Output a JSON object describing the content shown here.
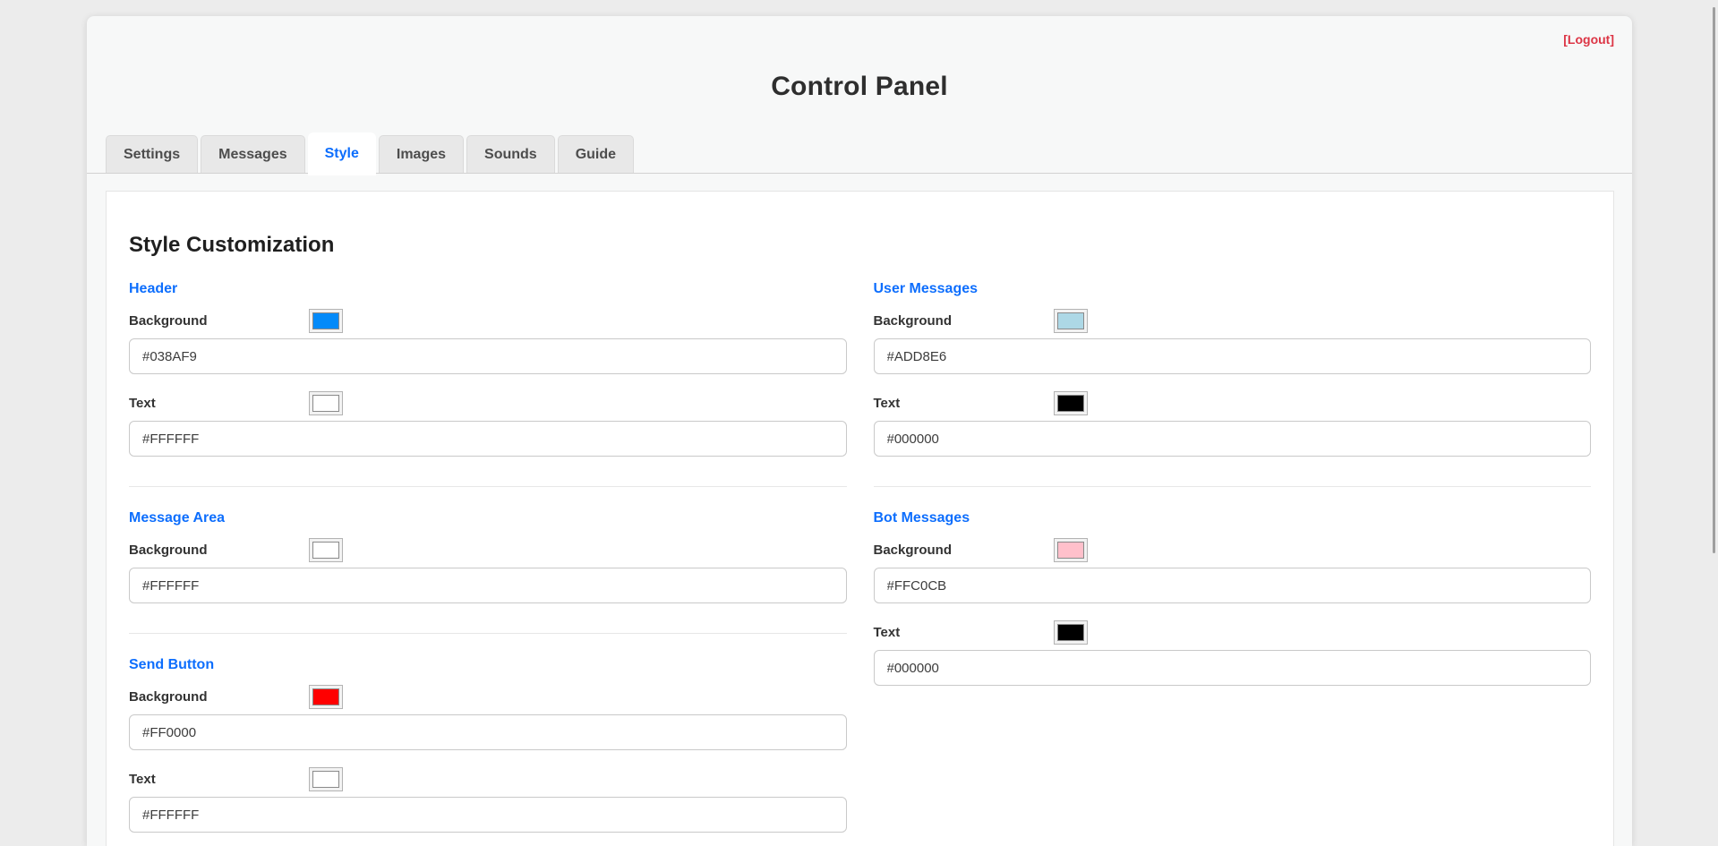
{
  "page": {
    "title": "Control Panel",
    "logout_label": "[Logout]"
  },
  "tabs": [
    {
      "label": "Settings",
      "active": false
    },
    {
      "label": "Messages",
      "active": false
    },
    {
      "label": "Style",
      "active": true
    },
    {
      "label": "Images",
      "active": false
    },
    {
      "label": "Sounds",
      "active": false
    },
    {
      "label": "Guide",
      "active": false
    }
  ],
  "style_tab": {
    "heading": "Style Customization",
    "columns": {
      "left": [
        {
          "title": "Header",
          "fields": [
            {
              "label": "Background",
              "value": "#038AF9"
            },
            {
              "label": "Text",
              "value": "#FFFFFF"
            }
          ]
        },
        {
          "title": "Message Area",
          "fields": [
            {
              "label": "Background",
              "value": "#FFFFFF"
            }
          ]
        },
        {
          "title": "Send Button",
          "fields": [
            {
              "label": "Background",
              "value": "#FF0000"
            },
            {
              "label": "Text",
              "value": "#FFFFFF"
            }
          ]
        }
      ],
      "right": [
        {
          "title": "User Messages",
          "fields": [
            {
              "label": "Background",
              "value": "#ADD8E6"
            },
            {
              "label": "Text",
              "value": "#000000"
            }
          ]
        },
        {
          "title": "Bot Messages",
          "fields": [
            {
              "label": "Background",
              "value": "#FFC0CB"
            },
            {
              "label": "Text",
              "value": "#000000"
            }
          ]
        }
      ]
    }
  },
  "colors": {
    "accent_blue": "#0d6efd",
    "logout_red": "#dc3545"
  }
}
